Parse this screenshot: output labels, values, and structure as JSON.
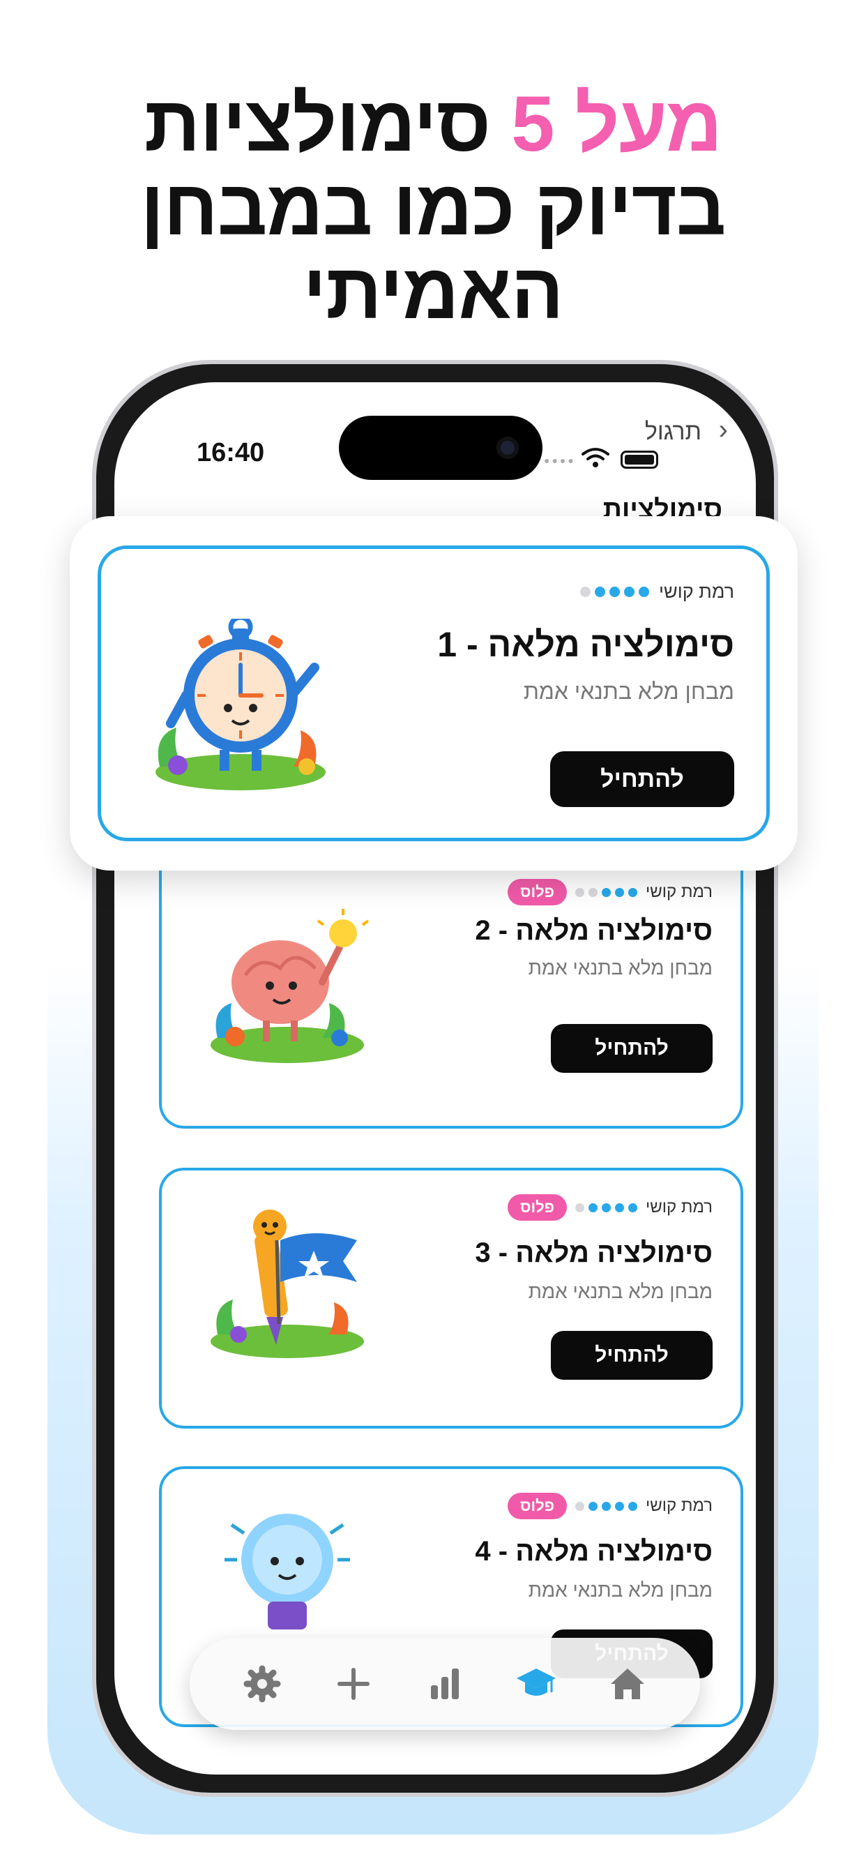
{
  "headline": {
    "accent": "מעל 5",
    "line1_rest": "סימולציות",
    "line2": "בדיוק כמו במבחן",
    "line3": "האמיתי"
  },
  "status_bar": {
    "time": "16:40",
    "back_label": "תרגול"
  },
  "page_title": "סימולציות",
  "difficulty_label": "רמת קושי",
  "plus_badge": "פלוס",
  "subtitle": "מבחן מלא בתנאי אמת",
  "start_label": "להתחיל",
  "cards": [
    {
      "title": "סימולציה מלאה - 1",
      "difficulty": 4,
      "plus": false,
      "art": "stopwatch-character"
    },
    {
      "title": "סימולציה מלאה - 2",
      "difficulty": 3,
      "plus": true,
      "art": "brain-character"
    },
    {
      "title": "סימולציה מלאה - 3",
      "difficulty": 4,
      "plus": true,
      "art": "pencil-flag-character"
    },
    {
      "title": "סימולציה מלאה - 4",
      "difficulty": 4,
      "plus": true,
      "art": "lightbulb-character"
    }
  ],
  "tabbar": {
    "items": [
      {
        "icon": "gear-icon",
        "active": false
      },
      {
        "icon": "plus-icon",
        "active": false
      },
      {
        "icon": "bar-chart-icon",
        "active": false
      },
      {
        "icon": "graduation-cap-icon",
        "active": true
      },
      {
        "icon": "home-icon",
        "active": false
      }
    ]
  },
  "colors": {
    "accent_blue": "#27a8e8",
    "accent_pink": "#f45fb0",
    "button_black": "#0b0b0b"
  }
}
